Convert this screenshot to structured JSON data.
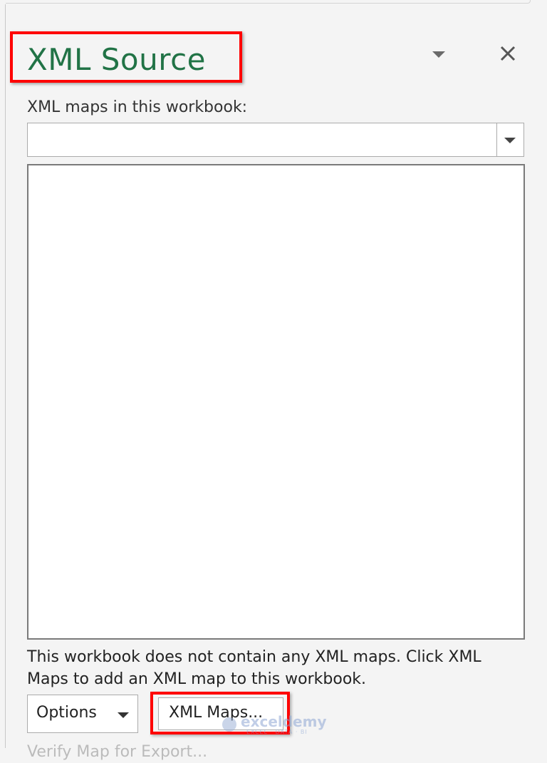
{
  "pane": {
    "title": "XML Source",
    "maps_label": "XML maps in this workbook:",
    "selected_map": "",
    "info_text": "This workbook does not contain any XML maps. Click XML Maps to add an XML map to this workbook.",
    "options_label": "Options",
    "xml_maps_label": "XML Maps...",
    "cut_off_text": "Verify Map for Export..."
  },
  "icons": {
    "pane_options": "chevron-down-icon",
    "close": "close-icon",
    "dropdown": "chevron-down-icon"
  },
  "watermark": {
    "name": "exceldemy",
    "tagline": "EXCEL · DATA · BI"
  },
  "colors": {
    "title": "#217346",
    "highlight": "#ff0000",
    "background": "#f4f4f4"
  }
}
